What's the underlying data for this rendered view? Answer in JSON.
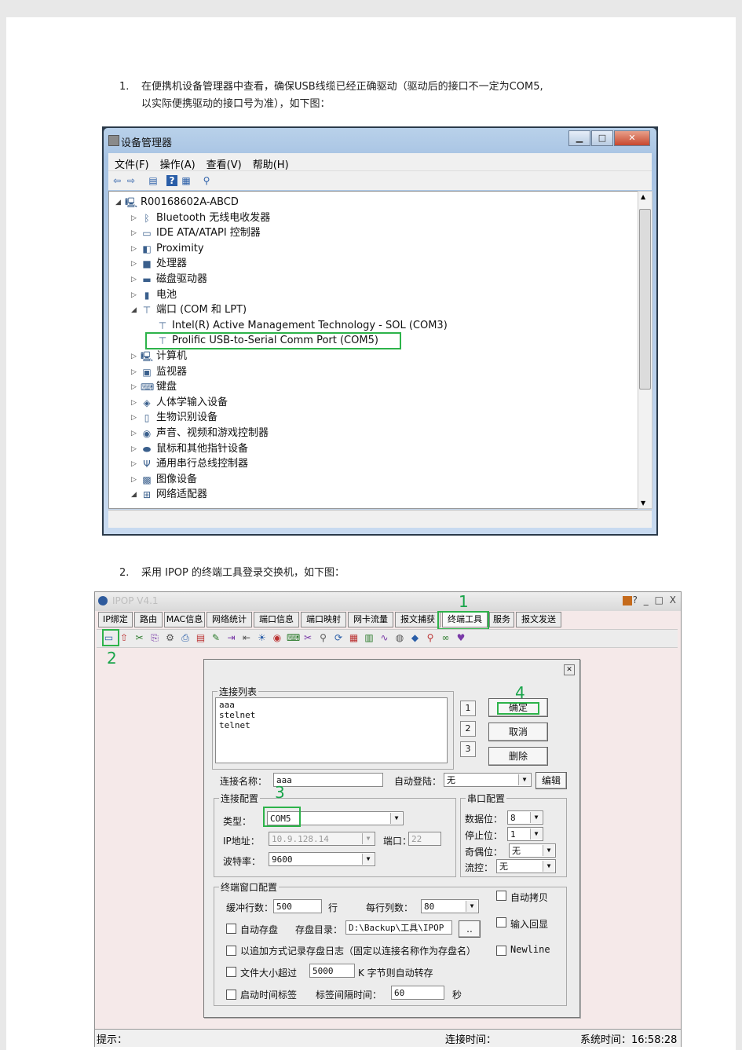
{
  "step1": {
    "num": "1.",
    "line1": "在便携机设备管理器中查看，确保USB线缆已经正确驱动（驱动后的接口不一定为COM5,",
    "line2": "以实际便携驱动的接口号为准），如下图："
  },
  "device_manager": {
    "title": "设备管理器",
    "menu": [
      "文件(F)",
      "操作(A)",
      "查看(V)",
      "帮助(H)"
    ],
    "tree": [
      {
        "label": "R00168602A-ABCD",
        "icon": "computer-icon",
        "level": 0,
        "expand": "◢"
      },
      {
        "label": "Bluetooth 无线电收发器",
        "icon": "bluetooth-icon",
        "level": 1,
        "expand": "▷"
      },
      {
        "label": "IDE ATA/ATAPI 控制器",
        "icon": "ide-controller-icon",
        "level": 1,
        "expand": "▷"
      },
      {
        "label": "Proximity",
        "icon": "proximity-icon",
        "level": 1,
        "expand": "▷"
      },
      {
        "label": "处理器",
        "icon": "processor-icon",
        "level": 1,
        "expand": "▷"
      },
      {
        "label": "磁盘驱动器",
        "icon": "disk-drive-icon",
        "level": 1,
        "expand": "▷"
      },
      {
        "label": "电池",
        "icon": "battery-icon",
        "level": 1,
        "expand": "▷"
      },
      {
        "label": "端口 (COM 和 LPT)",
        "icon": "port-icon",
        "level": 1,
        "expand": "◢"
      },
      {
        "label": "Intel(R) Active Management Technology - SOL (COM3)",
        "icon": "port-icon",
        "level": 2,
        "expand": ""
      },
      {
        "label": "Prolific USB-to-Serial Comm Port (COM5)",
        "icon": "port-icon",
        "level": 2,
        "expand": ""
      },
      {
        "label": "计算机",
        "icon": "computer-icon",
        "level": 1,
        "expand": "▷"
      },
      {
        "label": "监视器",
        "icon": "monitor-icon",
        "level": 1,
        "expand": "▷"
      },
      {
        "label": "键盘",
        "icon": "keyboard-icon",
        "level": 1,
        "expand": "▷"
      },
      {
        "label": "人体学输入设备",
        "icon": "hid-icon",
        "level": 1,
        "expand": "▷"
      },
      {
        "label": "生物识别设备",
        "icon": "biometric-icon",
        "level": 1,
        "expand": "▷"
      },
      {
        "label": "声音、视频和游戏控制器",
        "icon": "sound-icon",
        "level": 1,
        "expand": "▷"
      },
      {
        "label": "鼠标和其他指针设备",
        "icon": "mouse-icon",
        "level": 1,
        "expand": "▷"
      },
      {
        "label": "通用串行总线控制器",
        "icon": "usb-icon",
        "level": 1,
        "expand": "▷"
      },
      {
        "label": "图像设备",
        "icon": "imaging-icon",
        "level": 1,
        "expand": "▷"
      },
      {
        "label": "网络适配器",
        "icon": "network-icon",
        "level": 1,
        "expand": "◢"
      }
    ]
  },
  "step2": {
    "num": "2.",
    "text": "采用 IPOP 的终端工具登录交换机，如下图："
  },
  "ipop": {
    "title": "IPOP V4.1",
    "title_buttons": "? _ □ X",
    "tabs": [
      "IP绑定",
      "路由",
      "MAC信息",
      "网络统计",
      "端口信息",
      "端口映射",
      "网卡流量",
      "报文捕获",
      "终端工具",
      "服务",
      "报文发送"
    ],
    "markers": [
      "1",
      "2",
      "3",
      "4"
    ],
    "status": {
      "hint": "提示：",
      "conn_time": "连接时间：",
      "sys_time": "系统时间：16:58:28"
    }
  },
  "dialog": {
    "conn_list_title": "连接列表",
    "conn_list": [
      "aaa",
      "stelnet",
      "telnet"
    ],
    "num_buttons": [
      "1",
      "2",
      "3"
    ],
    "ok": "确定",
    "cancel": "取消",
    "delete": "删除",
    "conn_name_label": "连接名称：",
    "conn_name": "aaa",
    "auto_login_label": "自动登陆：",
    "auto_login": "无",
    "edit": "编辑",
    "conn_cfg_title": "连接配置",
    "type_label": "类型：",
    "type": "COM5",
    "ip_label": "IP地址：",
    "ip": "10.9.128.14",
    "port_label": "端口：",
    "port": "22",
    "baud_label": "波特率：",
    "baud": "9600",
    "serial_cfg_title": "串口配置",
    "data_bits_label": "数据位：",
    "data_bits": "8",
    "stop_bits_label": "停止位：",
    "stop_bits": "1",
    "parity_label": "奇偶位：",
    "parity": "无",
    "flow_label": "流控：",
    "flow": "无",
    "term_cfg_title": "终端窗口配置",
    "buffer_label": "缓冲行数：",
    "buffer": "500",
    "line_unit": "行",
    "cols_label": "每行列数：",
    "cols": "80",
    "auto_copy": "自动拷贝",
    "auto_save": "自动存盘",
    "save_dir_label": "存盘目录：",
    "save_dir": "D:\\Backup\\工具\\IPOP",
    "browse": "..",
    "echo": "输入回显",
    "append_log": "以追加方式记录存盘日志（固定以连接名称作为存盘名）",
    "newline": "Newline",
    "size_label": "文件大小超过",
    "size": "5000",
    "size_unit": "K 字节则自动转存",
    "timestamp": "启动时间标签",
    "interval_label": "标签间隔时间：",
    "interval": "60",
    "sec": "秒"
  }
}
